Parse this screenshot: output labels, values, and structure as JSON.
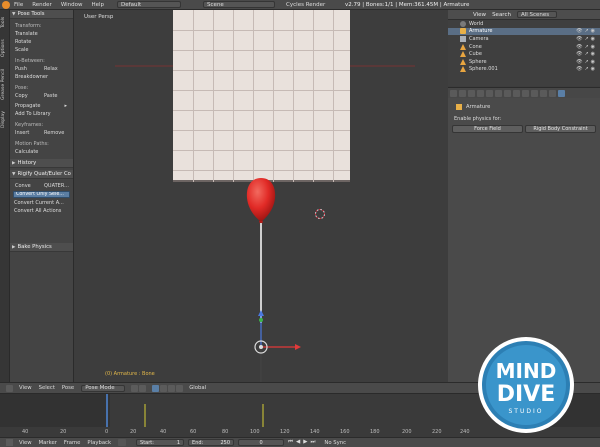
{
  "topbar": {
    "menus": [
      "File",
      "Render",
      "Window",
      "Help"
    ],
    "layout": "Default",
    "scene": "Scene",
    "engine": "Cycles Render",
    "stats": "v2.79 | Bones:1/1 | Mem:361.45M | Armature"
  },
  "left_tabs": [
    "Tools",
    "Options",
    "Grease Pencil",
    "Display"
  ],
  "toolshelf": {
    "pose_tools": {
      "title": "Pose Tools",
      "transform_label": "Transform:",
      "translate": "Translate",
      "rotate": "Rotate",
      "scale": "Scale",
      "inbetween_label": "In-Between:",
      "push": "Push",
      "relax": "Relax",
      "breakdowner": "Breakdowner",
      "pose_label": "Pose:",
      "copy": "Copy",
      "paste": "Paste",
      "propagate": "Propagate",
      "add_to_library": "Add To Library",
      "keyframes_label": "Keyframes:",
      "insert": "Insert",
      "remove": "Remove",
      "motion_paths_label": "Motion Paths:",
      "calculate": "Calculate"
    },
    "history": "History",
    "rigify": {
      "title": "Rigify Quat/Euler Co",
      "conv_label": "Conve",
      "conv_value": "QUATER...",
      "convert_only_selected": "Convert Only Sele...",
      "convert_current_action": "Convert Current A...",
      "convert_all_actions": "Convert All Actions"
    },
    "bake_physics": "Bake Physics"
  },
  "viewport": {
    "label": "User Persp",
    "footer": "(0) Armature : Bone"
  },
  "outliner": {
    "view": "View",
    "search": "Search",
    "filter": "All Scenes",
    "rows": [
      {
        "name": "World",
        "selected": false
      },
      {
        "name": "Armature",
        "selected": true
      },
      {
        "name": "Camera",
        "selected": false
      },
      {
        "name": "Cone",
        "selected": false
      },
      {
        "name": "Cube",
        "selected": false
      },
      {
        "name": "Sphere",
        "selected": false
      },
      {
        "name": "Sphere.001",
        "selected": false
      }
    ]
  },
  "properties": {
    "context": "Armature",
    "enable_physics_label": "Enable physics for:",
    "force_field": "Force Field",
    "rigid_body_constraint": "Rigid Body Constraint"
  },
  "viewport_header": {
    "menus": [
      "View",
      "Select",
      "Pose"
    ],
    "mode": "Pose Mode",
    "orientation": "Global"
  },
  "timeline": {
    "ruler": [
      "40",
      "20",
      "0",
      "20",
      "40",
      "60",
      "80",
      "100",
      "120",
      "140",
      "160",
      "180",
      "200",
      "220",
      "240"
    ],
    "menus": [
      "View",
      "Marker",
      "Frame",
      "Playback"
    ],
    "start_label": "Start:",
    "start": "1",
    "end_label": "End:",
    "end": "250",
    "current": "0",
    "sync": "No Sync"
  },
  "logo": {
    "text_top": "MIND",
    "text_mid": "DIVE",
    "text_bottom": "STUDIO"
  },
  "colors": {
    "balloon": "#e12a26",
    "accent": "#5a7fa6",
    "logo_ring": "#2c7fb4"
  }
}
